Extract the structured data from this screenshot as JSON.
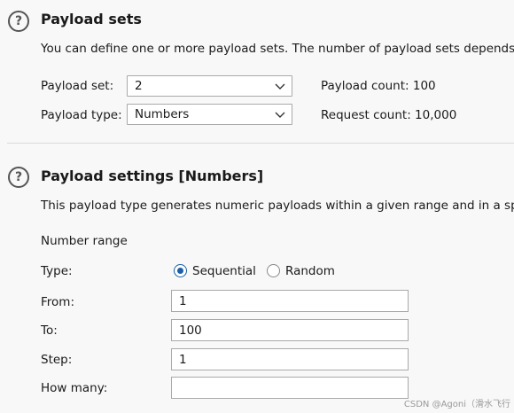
{
  "payload_sets": {
    "title": "Payload sets",
    "description": "You can define one or more payload sets. The number of payload sets depends",
    "payload_set_label": "Payload set:",
    "payload_set_value": "2",
    "payload_type_label": "Payload type:",
    "payload_type_value": "Numbers",
    "payload_count": "Payload count: 100",
    "request_count": "Request count: 10,000"
  },
  "payload_settings": {
    "title": "Payload settings [Numbers]",
    "description": "This payload type generates numeric payloads within a given range and in a spe",
    "number_range_label": "Number range",
    "type_label": "Type:",
    "sequential_label": "Sequential",
    "random_label": "Random",
    "selected_type": "Sequential",
    "from_label": "From:",
    "from_value": "1",
    "to_label": "To:",
    "to_value": "100",
    "step_label": "Step:",
    "step_value": "1",
    "how_many_label": "How many:",
    "how_many_value": ""
  },
  "help_glyph": "?",
  "watermark": "CSDN @Agoni（滑水飞行",
  "colors": {
    "radio_accent": "#1a5fa8",
    "background": "#f8f8f8"
  }
}
